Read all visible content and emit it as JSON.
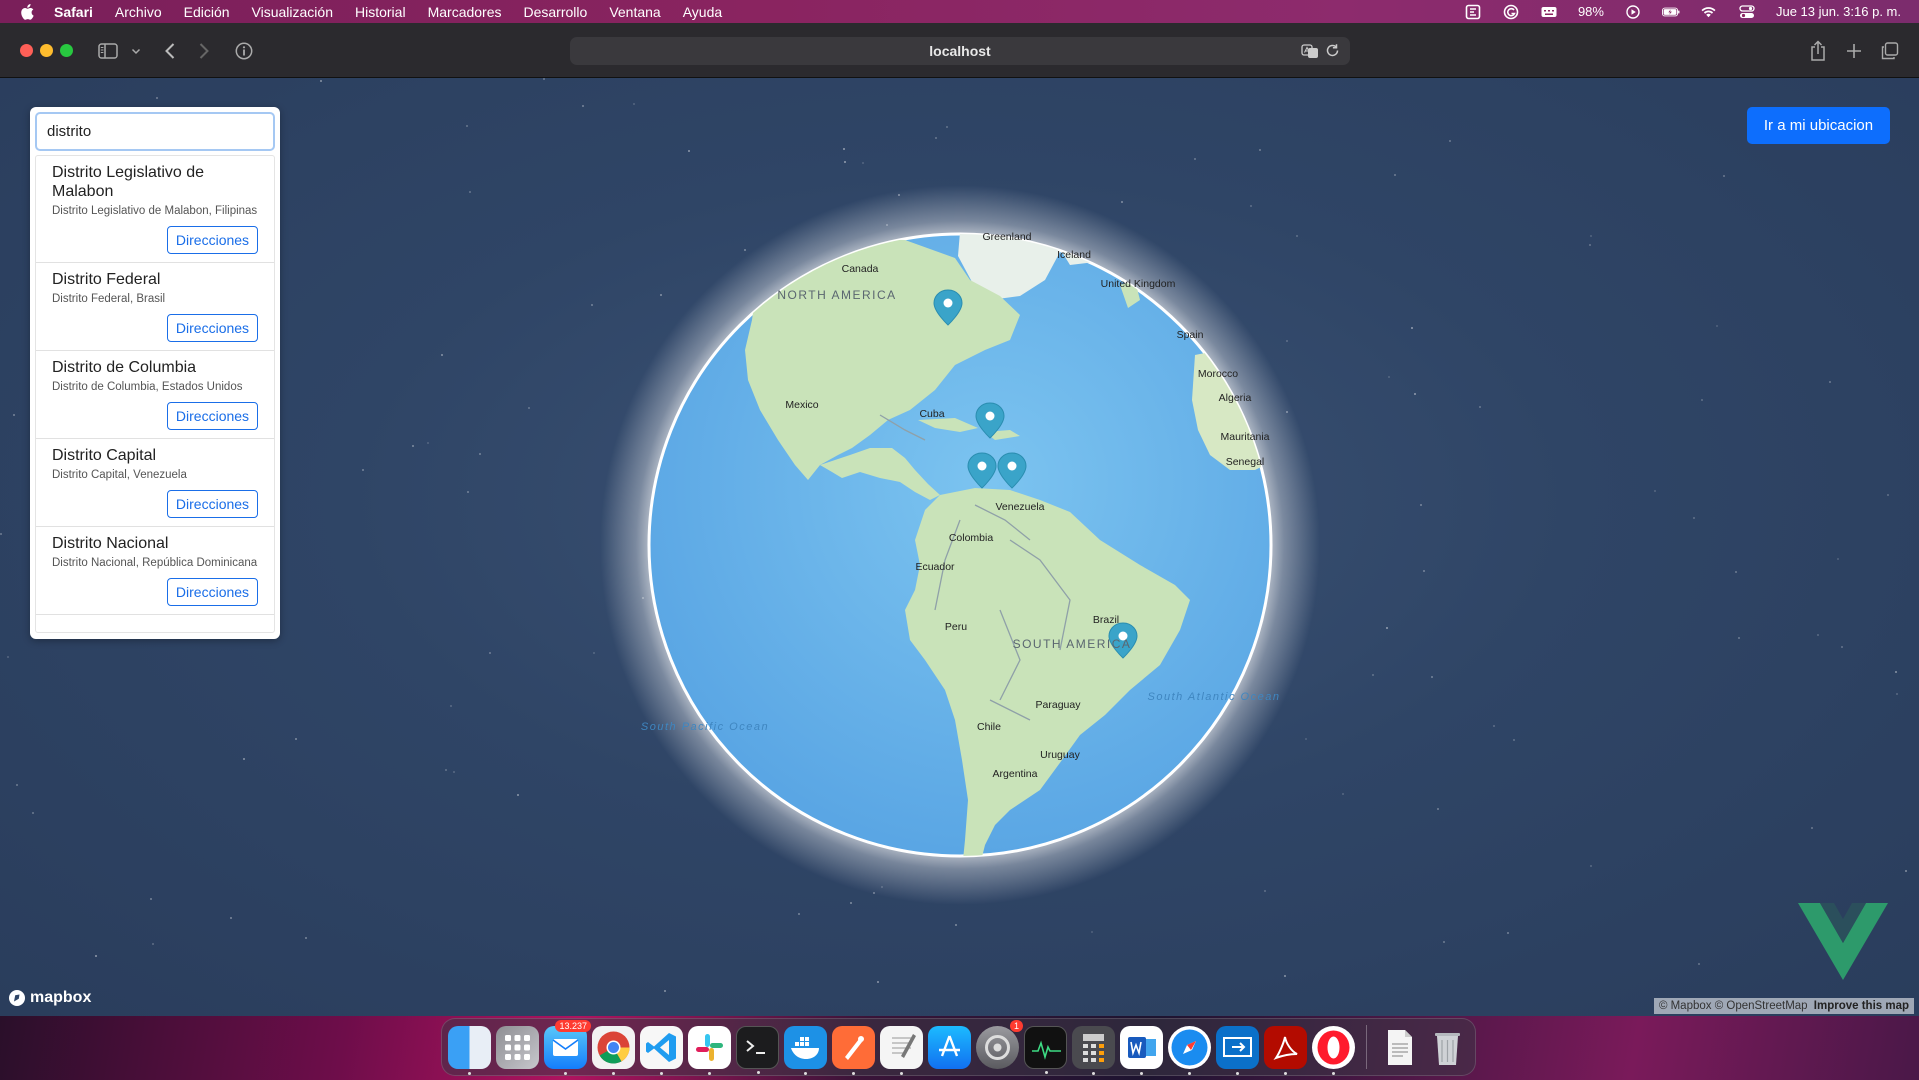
{
  "menubar": {
    "app": "Safari",
    "items": [
      "Archivo",
      "Edición",
      "Visualización",
      "Historial",
      "Marcadores",
      "Desarrollo",
      "Ventana",
      "Ayuda"
    ],
    "battery": "98%",
    "datetime": "Jue 13 jun.  3:16 p. m."
  },
  "browser": {
    "url": "localhost"
  },
  "search": {
    "value": "distrito",
    "results": [
      {
        "title": "Distrito Legislativo de Malabon",
        "subtitle": "Distrito Legislativo de Malabon, Filipinas",
        "button": "Direcciones"
      },
      {
        "title": "Distrito Federal",
        "subtitle": "Distrito Federal, Brasil",
        "button": "Direcciones"
      },
      {
        "title": "Distrito de Columbia",
        "subtitle": "Distrito de Columbia, Estados Unidos",
        "button": "Direcciones"
      },
      {
        "title": "Distrito Capital",
        "subtitle": "Distrito Capital, Venezuela",
        "button": "Direcciones"
      },
      {
        "title": "Distrito Nacional",
        "subtitle": "Distrito Nacional, República Dominicana",
        "button": "Direcciones"
      }
    ]
  },
  "location_button": "Ir a mi ubicacion",
  "map": {
    "labels": {
      "greenland": "Greenland",
      "iceland": "Iceland",
      "canada": "Canada",
      "united_kingdom": "United Kingdom",
      "north_america": "NORTH AMERICA",
      "spain": "Spain",
      "morocco": "Morocco",
      "algeria": "Algeria",
      "mexico": "Mexico",
      "cuba": "Cuba",
      "mauritania": "Mauritania",
      "senegal": "Senegal",
      "venezuela": "Venezuela",
      "colombia": "Colombia",
      "ecuador": "Ecuador",
      "peru": "Peru",
      "brazil": "Brazil",
      "south_america": "SOUTH AMERICA",
      "paraguay": "Paraguay",
      "chile": "Chile",
      "uruguay": "Uruguay",
      "argentina": "Argentina",
      "south_pacific": "South Pacific Ocean",
      "south_atlantic": "South Atlantic Ocean"
    },
    "logo": "mapbox",
    "attribution": "© Mapbox © OpenStreetMap",
    "improve": "Improve this map"
  },
  "dock": {
    "mail_badge": "13.237",
    "settings_badge": "1",
    "apps": [
      "finder",
      "launchpad",
      "mail",
      "chrome",
      "vscode",
      "slack",
      "terminal",
      "docker",
      "postman",
      "textedit",
      "app-store",
      "system-preferences",
      "activity-monitor",
      "calculator",
      "word",
      "safari",
      "remote-desktop",
      "acrobat",
      "opera",
      "document",
      "trash"
    ]
  },
  "colors": {
    "accent": "#0d6efd",
    "marker": "#3aa4c9",
    "ocean": "#73b8e8",
    "land": "#c8e2b9"
  }
}
